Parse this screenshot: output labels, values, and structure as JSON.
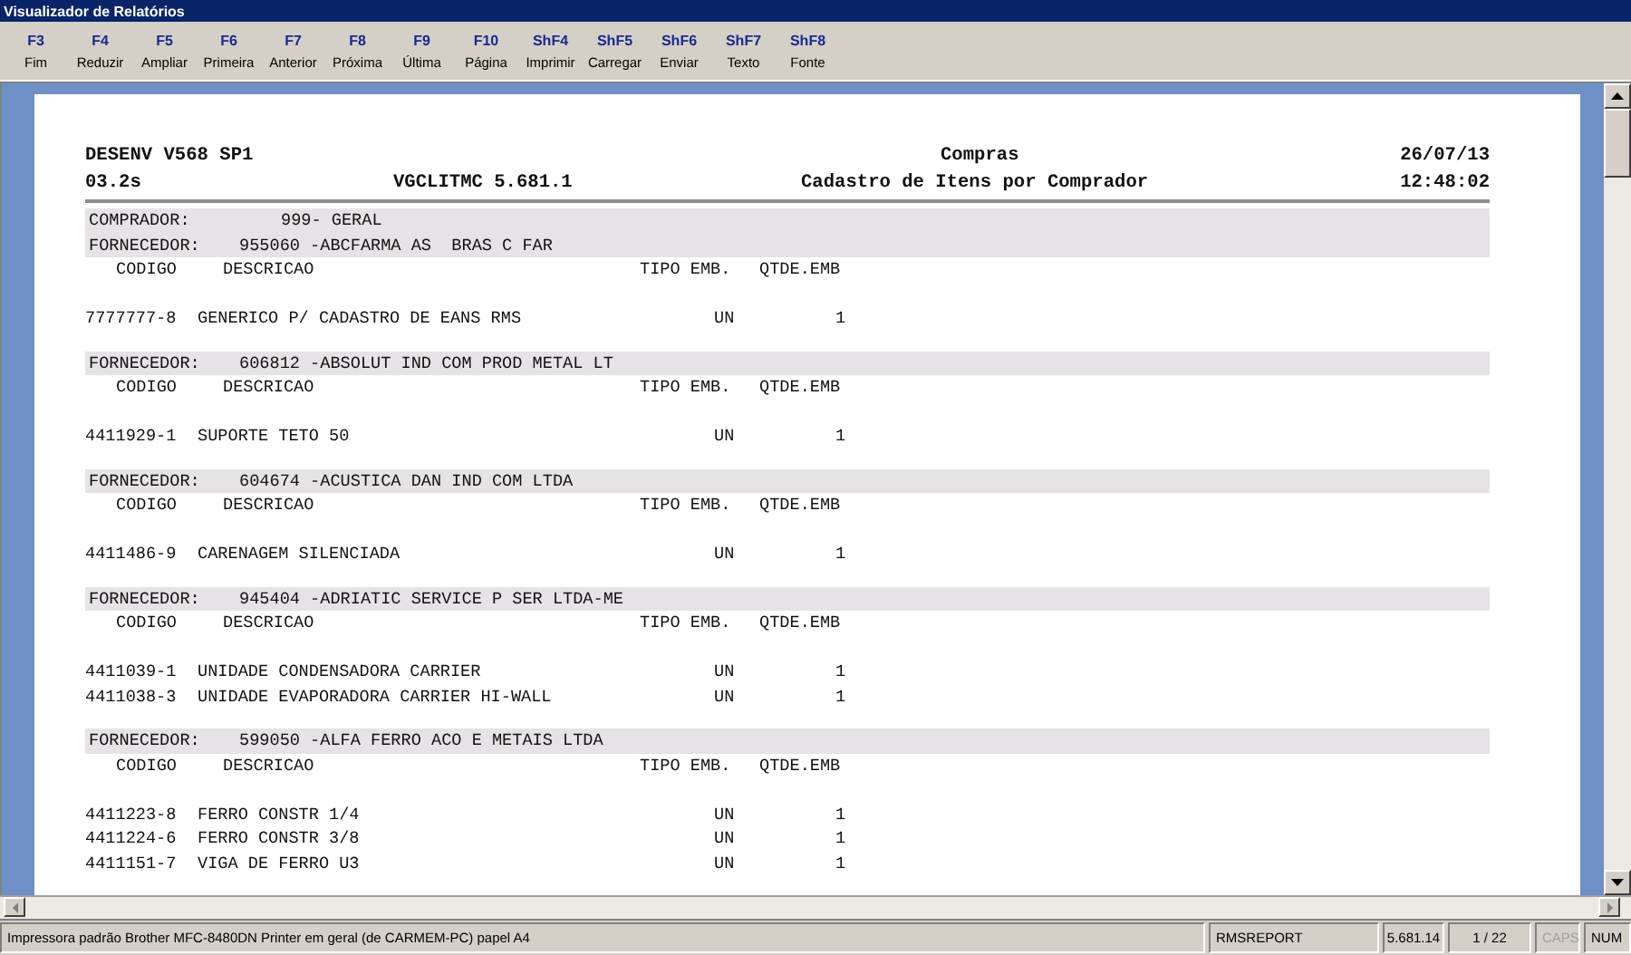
{
  "window": {
    "title": "Visualizador de Relatórios"
  },
  "toolbar": [
    {
      "key": "F3",
      "label": "Fim"
    },
    {
      "key": "F4",
      "label": "Reduzir"
    },
    {
      "key": "F5",
      "label": "Ampliar"
    },
    {
      "key": "F6",
      "label": "Primeira"
    },
    {
      "key": "F7",
      "label": "Anterior"
    },
    {
      "key": "F8",
      "label": "Próxima"
    },
    {
      "key": "F9",
      "label": "Última"
    },
    {
      "key": "F10",
      "label": "Página"
    },
    {
      "key": "ShF4",
      "label": "Imprimir"
    },
    {
      "key": "ShF5",
      "label": "Carregar"
    },
    {
      "key": "ShF6",
      "label": "Enviar"
    },
    {
      "key": "ShF7",
      "label": "Texto"
    },
    {
      "key": "ShF8",
      "label": "Fonte"
    }
  ],
  "report": {
    "header": {
      "system": "DESENV V568 SP1",
      "module": "Compras",
      "date": "26/07/13",
      "elapsed": "03.2s",
      "program": "VGCLITMC 5.681.1",
      "title": "Cadastro de Itens por Comprador",
      "time": "12:48:02"
    },
    "buyer": {
      "label": "COMPRADOR:",
      "value": "999- GERAL"
    },
    "suppliers": [
      {
        "label": "FORNECEDOR:",
        "value": "955060 -ABCFARMA AS  BRAS C FAR",
        "columns": [
          "CODIGO",
          "DESCRICAO",
          "TIPO EMB.",
          "QTDE.EMB"
        ],
        "items": [
          {
            "code": "7777777-8",
            "description": "GENERICO P/ CADASTRO DE EANS RMS",
            "unit": "UN",
            "qty": "1"
          }
        ]
      },
      {
        "label": "FORNECEDOR:",
        "value": "606812 -ABSOLUT IND COM PROD METAL LT",
        "columns": [
          "CODIGO",
          "DESCRICAO",
          "TIPO EMB.",
          "QTDE.EMB"
        ],
        "items": [
          {
            "code": "4411929-1",
            "description": "SUPORTE TETO 50",
            "unit": "UN",
            "qty": "1"
          }
        ]
      },
      {
        "label": "FORNECEDOR:",
        "value": "604674 -ACUSTICA DAN IND COM LTDA",
        "columns": [
          "CODIGO",
          "DESCRICAO",
          "TIPO EMB.",
          "QTDE.EMB"
        ],
        "items": [
          {
            "code": "4411486-9",
            "description": "CARENAGEM SILENCIADA",
            "unit": "UN",
            "qty": "1"
          }
        ]
      },
      {
        "label": "FORNECEDOR:",
        "value": "945404 -ADRIATIC SERVICE P SER LTDA-ME",
        "columns": [
          "CODIGO",
          "DESCRICAO",
          "TIPO EMB.",
          "QTDE.EMB"
        ],
        "items": [
          {
            "code": "4411039-1",
            "description": "UNIDADE CONDENSADORA CARRIER",
            "unit": "UN",
            "qty": "1"
          },
          {
            "code": "4411038-3",
            "description": "UNIDADE EVAPORADORA CARRIER HI-WALL",
            "unit": "UN",
            "qty": "1"
          }
        ]
      },
      {
        "label": "FORNECEDOR:",
        "value": "599050 -ALFA FERRO ACO E METAIS LTDA",
        "columns": [
          "CODIGO",
          "DESCRICAO",
          "TIPO EMB.",
          "QTDE.EMB"
        ],
        "items": [
          {
            "code": "4411223-8",
            "description": "FERRO CONSTR 1/4",
            "unit": "UN",
            "qty": "1"
          },
          {
            "code": "4411224-6",
            "description": "FERRO CONSTR 3/8",
            "unit": "UN",
            "qty": "1"
          },
          {
            "code": "4411151-7",
            "description": "VIGA DE FERRO U3",
            "unit": "UN",
            "qty": "1"
          }
        ]
      }
    ]
  },
  "status_bar": {
    "message": "Impressora padrão Brother MFC-8480DN Printer em geral (de CARMEM-PC) papel A4",
    "panes": [
      {
        "text": "RMSREPORT",
        "disabled": false
      },
      {
        "text": "5.681.14",
        "disabled": false
      },
      {
        "text": "1 / 22",
        "disabled": false
      },
      {
        "text": "CAPS",
        "disabled": true
      },
      {
        "text": "NUM",
        "disabled": false
      }
    ]
  }
}
